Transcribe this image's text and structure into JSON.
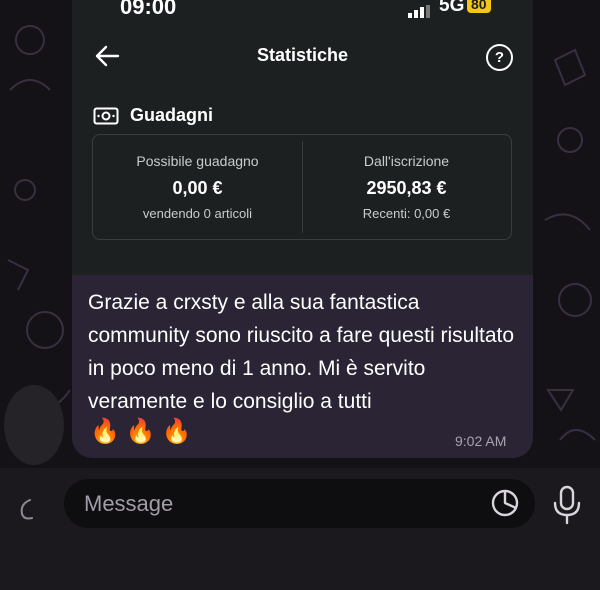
{
  "status_bar": {
    "time": "09:00",
    "network": "5G",
    "battery": "80"
  },
  "screenshot": {
    "title": "Statistiche",
    "help": "?",
    "section_title": "Guadagni",
    "left_card": {
      "label": "Possibile guadagno",
      "value": "0,00 €",
      "sub": "vendendo 0 articoli"
    },
    "right_card": {
      "label": "Dall'iscrizione",
      "value": "2950,83 €",
      "sub": "Recenti: 0,00 €"
    }
  },
  "message": {
    "text": "Grazie a crxsty e alla sua fantastica community sono riuscito a fare questi risultato in poco meno di 1 anno. Mi è servito veramente e lo consiglio a tutti",
    "emoji": "🔥🔥🔥",
    "time": "9:02 AM"
  },
  "input": {
    "placeholder": "Message"
  },
  "colors": {
    "bubble": "#2a2434",
    "screenshot_bg": "#1d2021",
    "battery": "#f5c518",
    "background": "#141216"
  }
}
